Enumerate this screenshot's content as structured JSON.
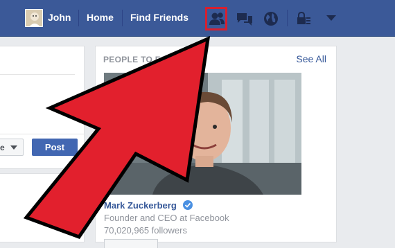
{
  "header": {
    "user_name": "John",
    "home_label": "Home",
    "find_friends_label": "Find Friends",
    "icons": [
      "friend-requests-icon",
      "messages-icon",
      "notifications-globe-icon",
      "privacy-lock-icon",
      "account-menu-chevron-icon"
    ],
    "highlight_color": "#d62030"
  },
  "composer": {
    "audience_partial": "e",
    "post_label": "Post"
  },
  "people_to_follow": {
    "title": "PEOPLE TO FO",
    "see_all_label": "See All",
    "person": {
      "name": "Mark Zuckerberg",
      "verified": true,
      "title": "Founder and CEO at Facebook",
      "followers": "70,020,965 followers"
    }
  },
  "annotation": {
    "type": "arrow",
    "color": "#e2202d",
    "points_to": "friend-requests-icon"
  },
  "colors": {
    "brand": "#3b5998",
    "link": "#365899",
    "button": "#4267b2",
    "background": "#e9ebee"
  }
}
